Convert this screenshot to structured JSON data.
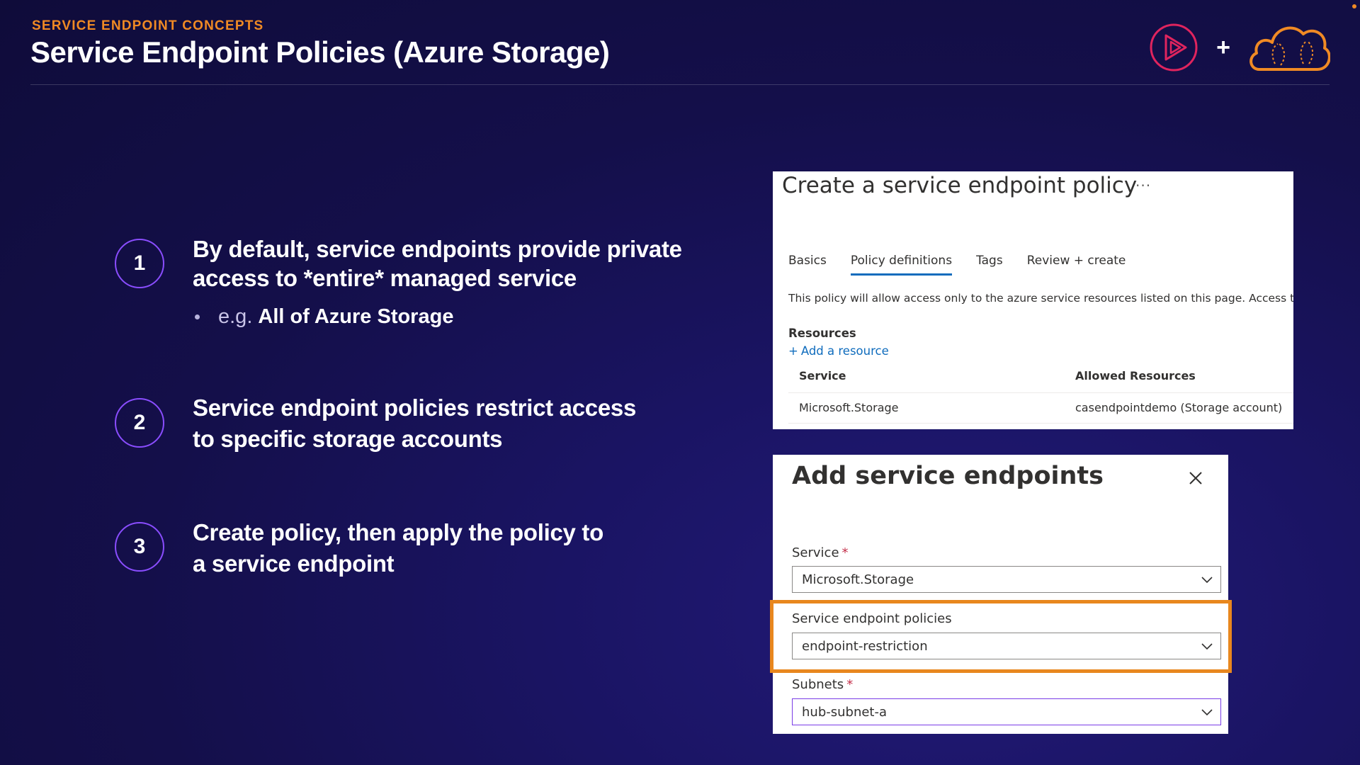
{
  "header": {
    "kicker": "SERVICE ENDPOINT CONCEPTS",
    "title": "Service Endpoint Policies (Azure Storage)",
    "plus": "+"
  },
  "steps": [
    {
      "number": "1",
      "text_line1": "By default, service endpoints provide private",
      "text_line2": "access to *entire* managed service"
    },
    {
      "number": "2",
      "text_line1": "Service endpoint policies restrict access",
      "text_line2": "to specific storage accounts"
    },
    {
      "number": "3",
      "text_line1": "Create policy, then apply the policy to",
      "text_line2": "a service endpoint"
    }
  ],
  "bullet": {
    "prefix": "e.g.",
    "strong": "All of Azure Storage"
  },
  "policy_panel": {
    "title": "Create a service endpoint policy",
    "more": "···",
    "tabs": [
      {
        "label": "Basics",
        "active": false
      },
      {
        "label": "Policy definitions",
        "active": true
      },
      {
        "label": "Tags",
        "active": false
      },
      {
        "label": "Review + create",
        "active": false
      }
    ],
    "description": "This policy will allow access only to the azure service resources listed on this page. Access to",
    "resources_heading": "Resources",
    "add_resource": "Add a resource",
    "add_resource_plus": "+",
    "columns": [
      "Service",
      "Allowed Resources"
    ],
    "rows": [
      {
        "service": "Microsoft.Storage",
        "allowed": "casendpointdemo (Storage account)"
      }
    ]
  },
  "endpoint_panel": {
    "title": "Add service endpoints",
    "service_label": "Service",
    "service_value": "Microsoft.Storage",
    "policies_label": "Service endpoint policies",
    "policies_value": "endpoint-restriction",
    "subnets_label": "Subnets",
    "subnets_value": "hub-subnet-a",
    "required_mark": "*"
  },
  "colors": {
    "accent_orange": "#f08a24",
    "step_ring": "#8a4dff",
    "link_blue": "#0f6cbd",
    "highlight_orange": "#e8871e",
    "background": "#140f4a"
  }
}
